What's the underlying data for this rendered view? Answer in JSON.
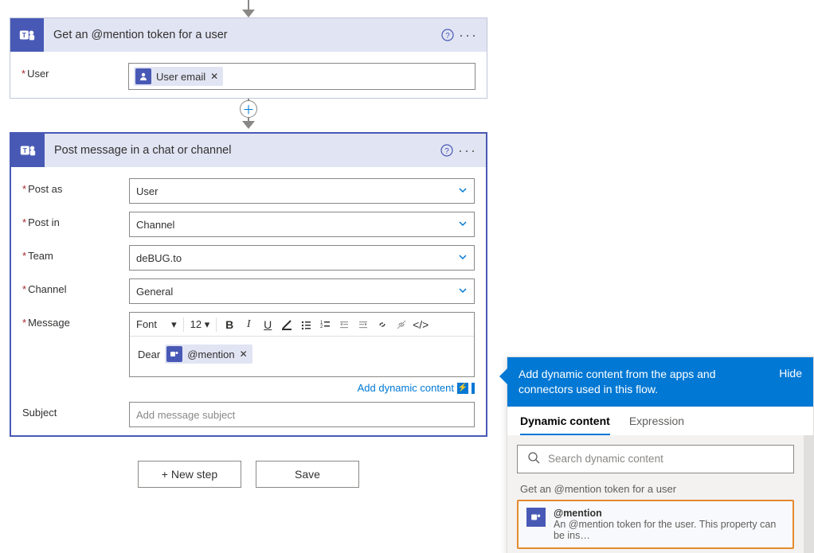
{
  "card1": {
    "title": "Get an @mention token for a user",
    "user_label": "User",
    "user_token": "User email"
  },
  "card2": {
    "title": "Post message in a chat or channel",
    "labels": {
      "post_as": "Post as",
      "post_in": "Post in",
      "team": "Team",
      "channel": "Channel",
      "message": "Message",
      "subject": "Subject"
    },
    "values": {
      "post_as": "User",
      "post_in": "Channel",
      "team": "deBUG.to",
      "channel": "General",
      "message_prefix": "Dear",
      "message_token": "@mention"
    },
    "subject_placeholder": "Add message subject",
    "rte": {
      "font": "Font",
      "size": "12"
    },
    "dyn_link": "Add dynamic content"
  },
  "actions": {
    "new_step": "+ New step",
    "save": "Save"
  },
  "dc": {
    "head_text": "Add dynamic content from the apps and connectors used in this flow.",
    "hide": "Hide",
    "tab_dynamic": "Dynamic content",
    "tab_expression": "Expression",
    "search_placeholder": "Search dynamic content",
    "group": "Get an @mention token for a user",
    "item_title": "@mention",
    "item_desc": "An @mention token for the user. This property can be ins…"
  }
}
